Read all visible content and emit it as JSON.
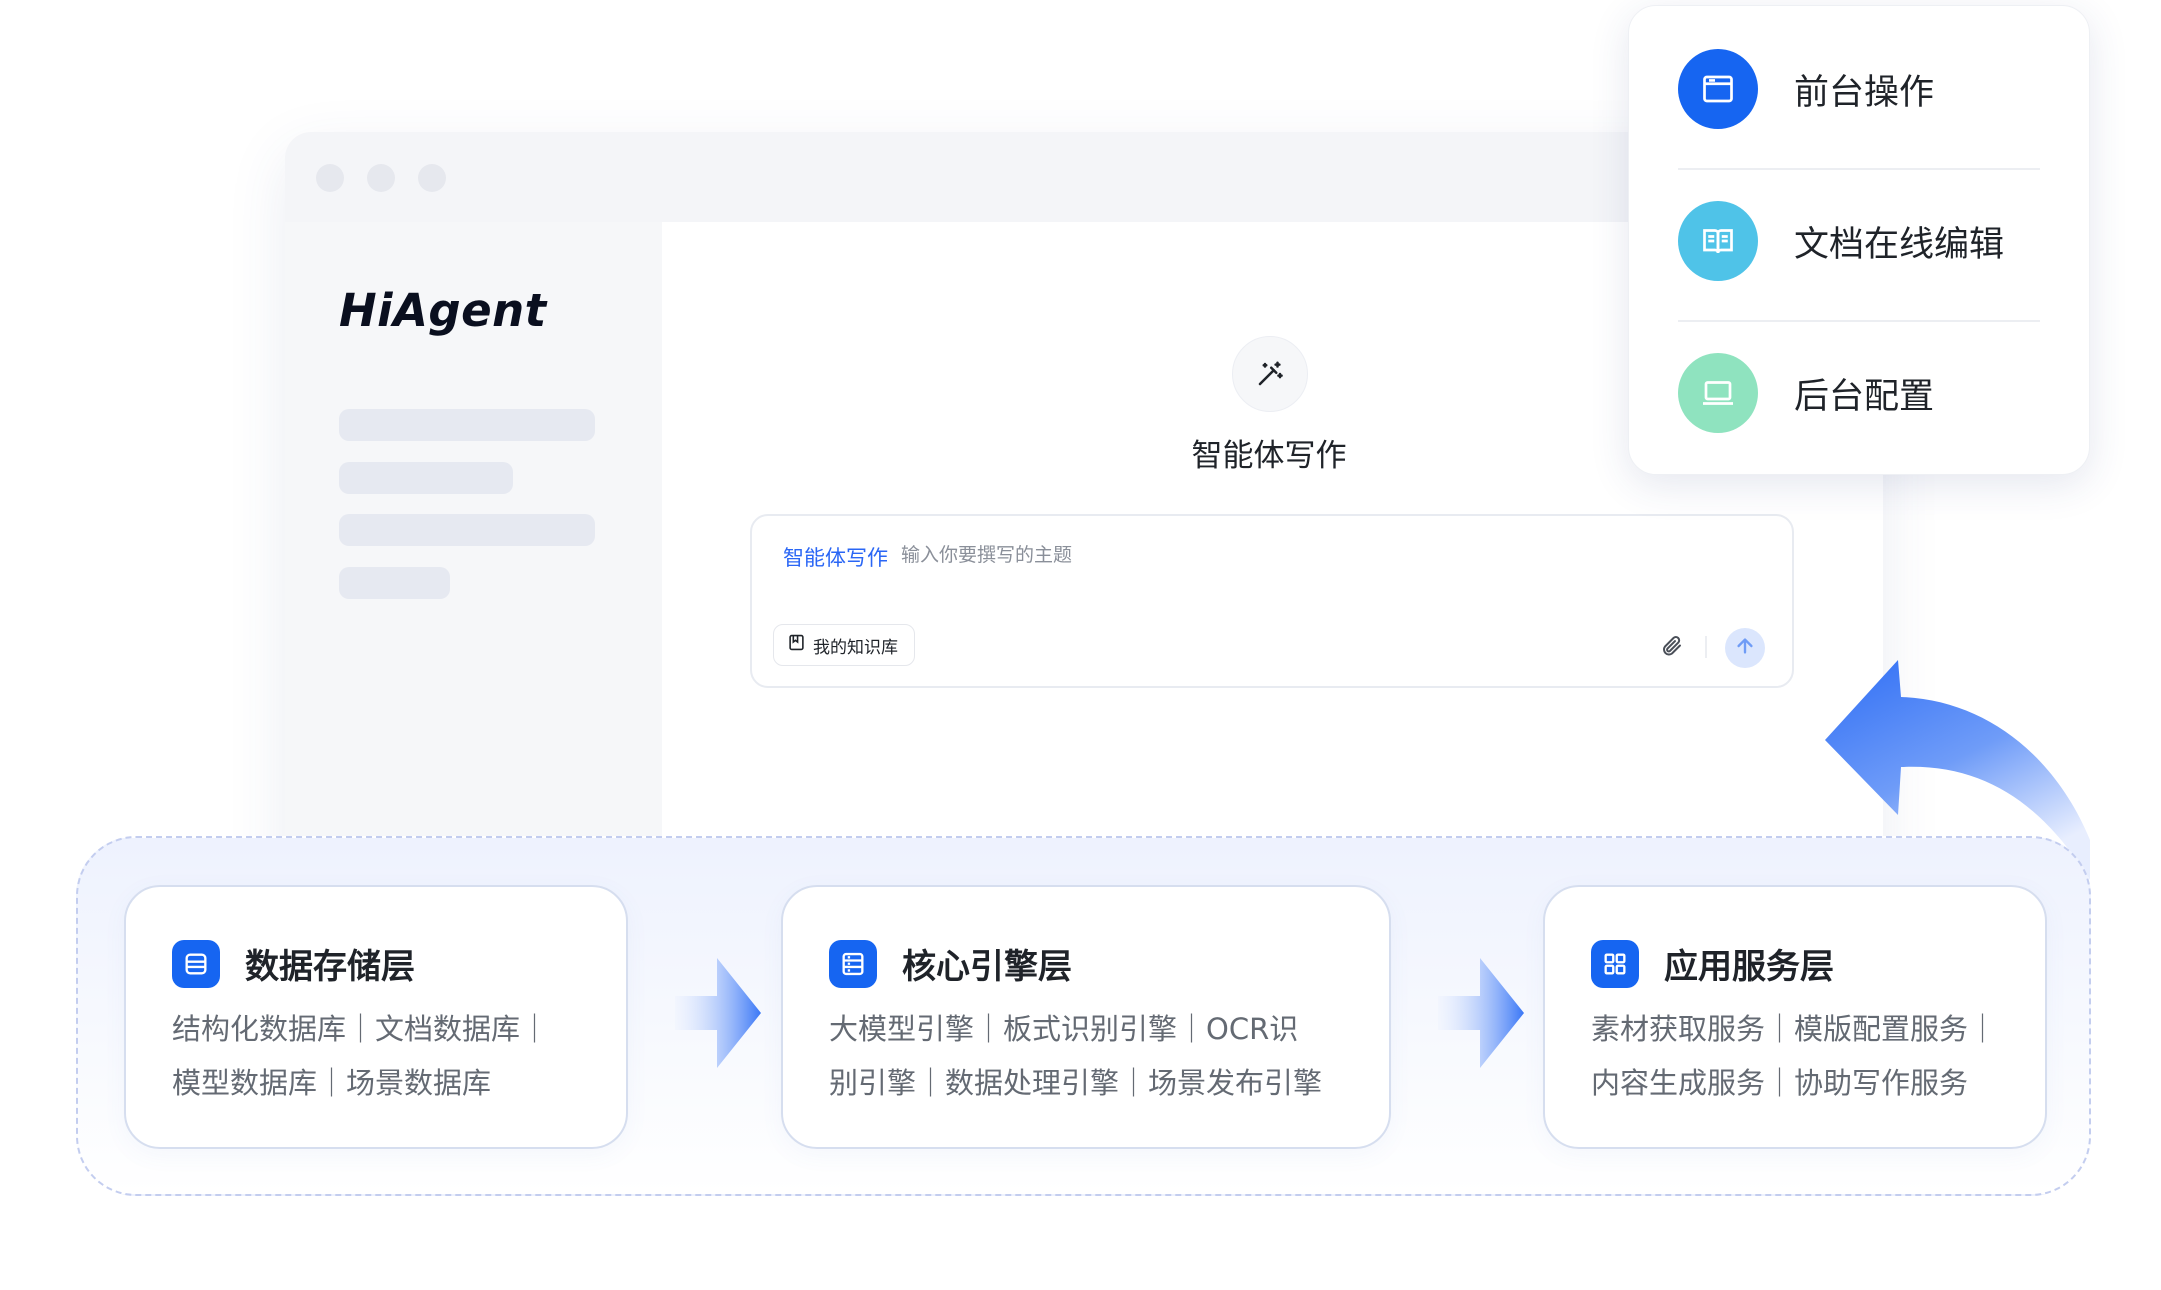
{
  "app": {
    "logo_text": "HiAgent"
  },
  "writer": {
    "title": "智能体写作",
    "icon": "magic-wand-icon",
    "input": {
      "tag": "智能体写作",
      "placeholder": "输入你要撰写的主题",
      "value": ""
    },
    "knowledge_button": "我的知识库"
  },
  "popup": {
    "items": [
      {
        "label": "前台操作",
        "icon": "window-icon",
        "color": "#1665f1"
      },
      {
        "label": "文档在线编辑",
        "icon": "book-icon",
        "color": "#4fc3e8"
      },
      {
        "label": "后台配置",
        "icon": "laptop-icon",
        "color": "#8fe3bf"
      }
    ]
  },
  "architecture": {
    "layers": [
      {
        "title": "数据存储层",
        "icon": "database-icon",
        "description": "结构化数据库｜文档数据库｜\n模型数据库｜场景数据库"
      },
      {
        "title": "核心引擎层",
        "icon": "server-icon",
        "description": "大模型引擎｜板式识别引擎｜OCR识\n别引擎｜数据处理引擎｜场景发布引擎"
      },
      {
        "title": "应用服务层",
        "icon": "grid-icon",
        "description": "素材获取服务｜模版配置服务｜\n内容生成服务｜协助写作服务"
      }
    ]
  },
  "colors": {
    "accent": "#1665f1",
    "arrow": "#4d86f7"
  }
}
